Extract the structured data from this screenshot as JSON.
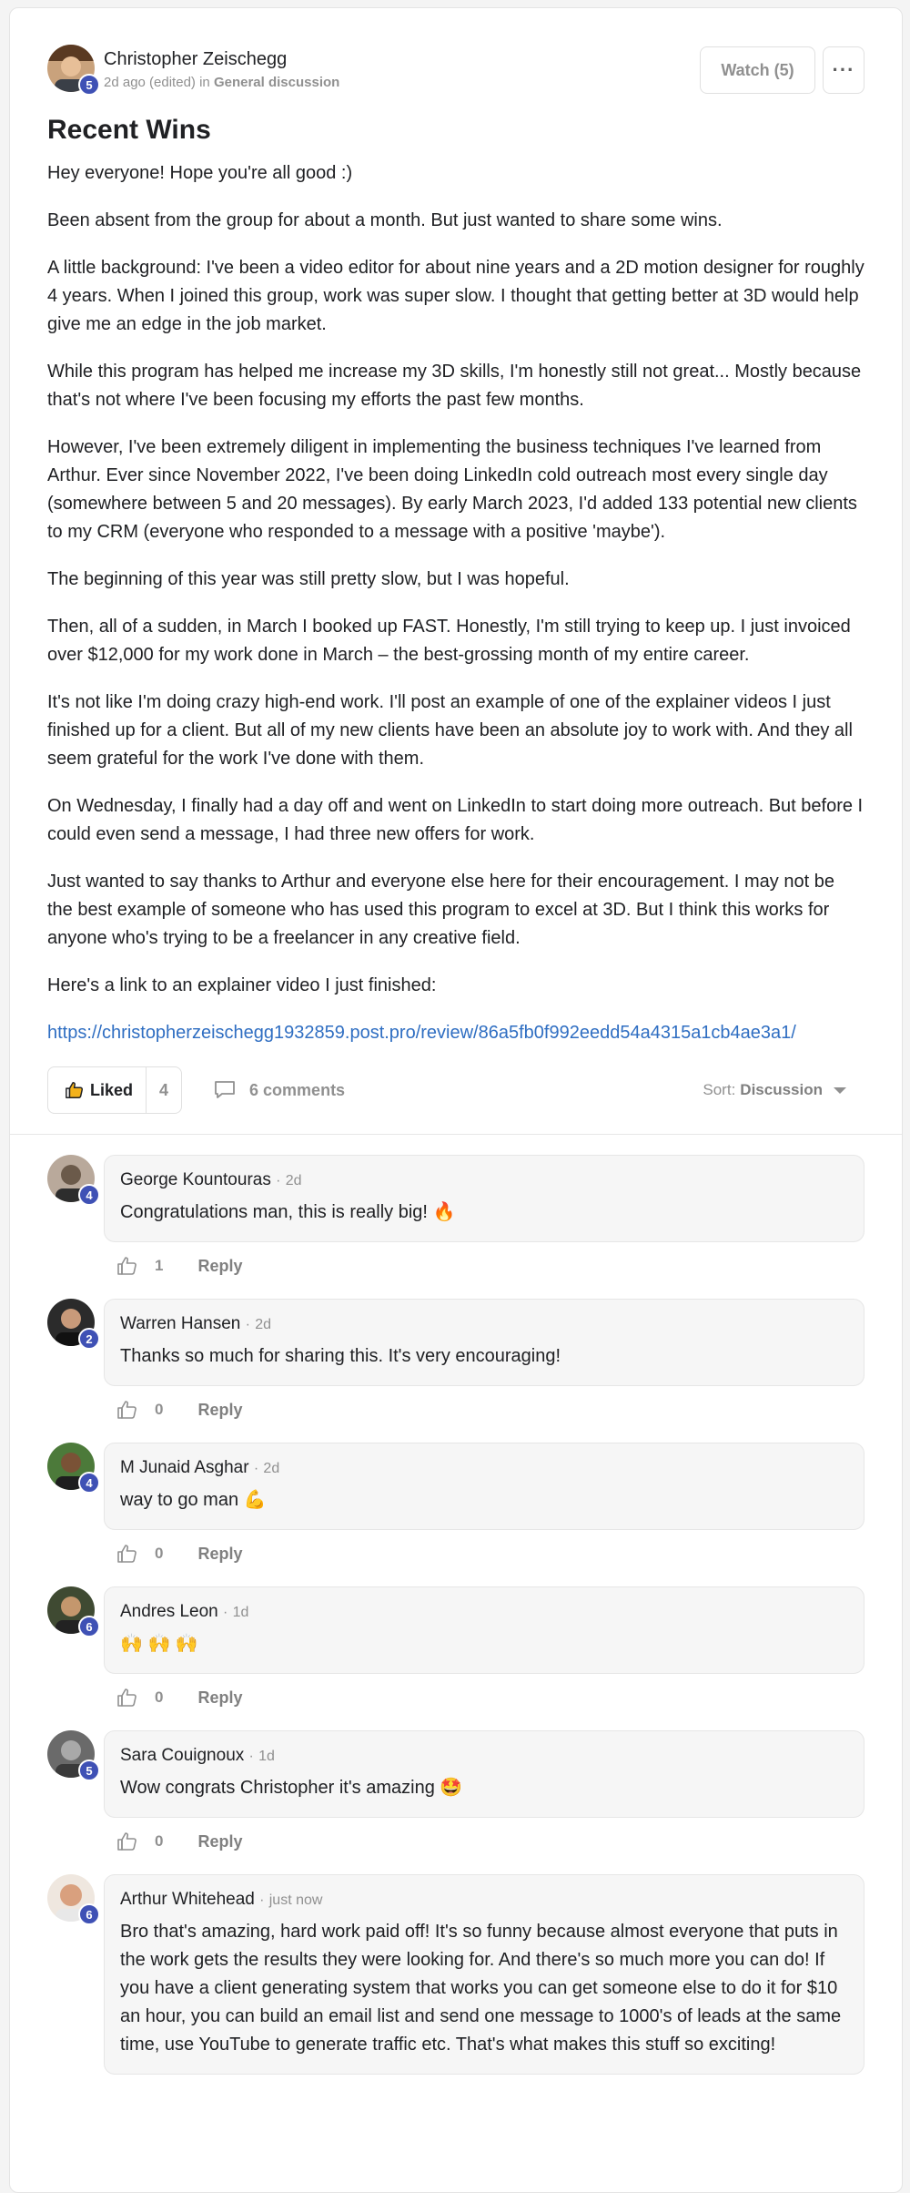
{
  "post": {
    "author": "Christopher Zeischegg",
    "author_level": "5",
    "time": "2d ago (edited)",
    "in_label": "in",
    "category": "General discussion",
    "watch_label": "Watch (5)",
    "more_label": "···",
    "title": "Recent Wins",
    "paragraphs": [
      "Hey everyone! Hope you're all good :)",
      "Been absent from the group for about a month. But just wanted to share some wins.",
      "A little background: I've been a video editor for about nine years and a 2D motion designer for roughly 4 years. When I joined this group, work was super slow. I thought that getting better at 3D would help give me an edge in the job market.",
      "While this program has helped me increase my 3D skills, I'm honestly still not great... Mostly because that's not where I've been focusing my efforts the past few months.",
      "However, I've been extremely diligent in implementing the business techniques I've learned from Arthur. Ever since November 2022, I've been doing LinkedIn cold outreach most every single day (somewhere between 5 and 20 messages). By early March 2023, I'd added 133 potential new clients to my CRM (everyone who responded to a message with a positive 'maybe').",
      "The beginning of this year was still pretty slow, but I was hopeful.",
      "Then, all of a sudden, in March I booked up FAST. Honestly, I'm still trying to keep up. I just invoiced over $12,000 for my work done in March – the best-grossing month of my entire career.",
      "It's not like I'm doing crazy high-end work. I'll post an example of one of the explainer videos I just finished up for a client. But all of my new clients have been an absolute joy to work with. And they all seem grateful for the work I've done with them.",
      "On Wednesday, I finally had a day off and went on LinkedIn to start doing more outreach. But before I could even send a message, I had three new offers for work.",
      "Just wanted to say thanks to Arthur and everyone else here for their encouragement. I may not be the best example of someone who has used this program to excel at 3D. But I think this works for anyone who's trying to be a freelancer in any creative field.",
      "Here's a link to an explainer video I just finished:"
    ],
    "link": "https://christopherzeischegg1932859.post.pro/review/86a5fb0f992eedd54a4315a1cb4ae3a1/",
    "liked_label": "Liked",
    "like_count": "4",
    "comments_label": "6 comments",
    "sort_label": "Sort:",
    "sort_value": "Discussion"
  },
  "comments": [
    {
      "name": "George Kountouras",
      "time": "2d",
      "level": "4",
      "text": "Congratulations man, this is really big! 🔥",
      "likes": "1",
      "reply": "Reply",
      "avatar_bg": "#b9a99b",
      "avatar_fg": "#6b5a4a"
    },
    {
      "name": "Warren Hansen",
      "time": "2d",
      "level": "2",
      "text": "Thanks so much for sharing this. It's very encouraging!",
      "likes": "0",
      "reply": "Reply",
      "avatar_bg": "#2b2b2b",
      "avatar_fg": "#c89a7a"
    },
    {
      "name": "M Junaid Asghar",
      "time": "2d",
      "level": "4",
      "text": "way to go man 💪",
      "likes": "0",
      "reply": "Reply",
      "avatar_bg": "#4c7a3a",
      "avatar_fg": "#7a5236"
    },
    {
      "name": "Andres Leon",
      "time": "1d",
      "level": "6",
      "text": "🙌 🙌 🙌",
      "likes": "0",
      "reply": "Reply",
      "avatar_bg": "#3f4a32",
      "avatar_fg": "#c4976d"
    },
    {
      "name": "Sara Couignoux",
      "time": "1d",
      "level": "5",
      "text": "Wow congrats Christopher it's amazing 🤩",
      "likes": "0",
      "reply": "Reply",
      "avatar_bg": "#6a6a6a",
      "avatar_fg": "#a9a9a9"
    },
    {
      "name": "Arthur Whitehead",
      "time": "just now",
      "level": "6",
      "text": "Bro that's amazing, hard work paid off! It's so funny because almost everyone that puts in the work gets the results they were looking for. And there's so much more you can do! If you have a client generating system that works you can get someone else to do it for $10 an hour, you can build an email list and send one message to 1000's of leads at the same time, use YouTube to generate traffic etc. That's what makes this stuff so exciting!",
      "likes": "",
      "reply": "",
      "avatar_bg": "#efe7df",
      "avatar_fg": "#d9a07e"
    }
  ],
  "colors": {
    "accent_link": "#2f6ec2",
    "level_badge": "#3f51b5",
    "muted_text": "#909090"
  }
}
